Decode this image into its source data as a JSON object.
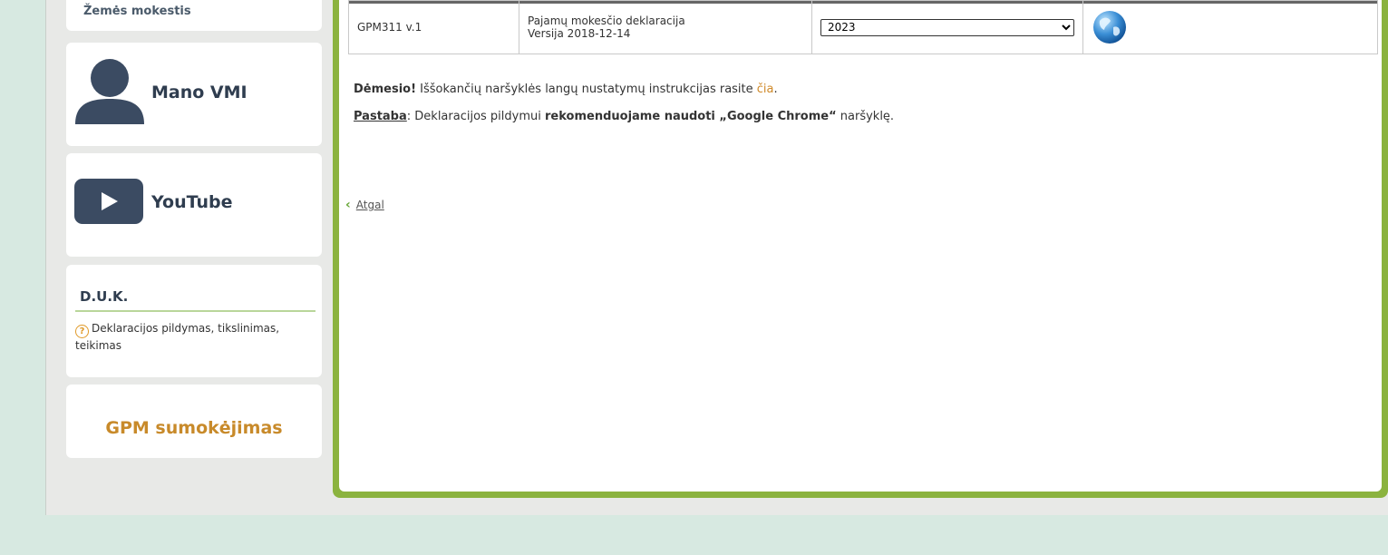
{
  "sidebar": {
    "land_tax": "Žemės mokestis",
    "mano_vmi": "Mano VMI",
    "youtube": "YouTube",
    "duk_title": "D.U.K.",
    "duk_link": "Deklaracijos pildymas, tikslinimas, teikimas",
    "gpm_payment": "GPM sumokėjimas"
  },
  "table": {
    "form_code": "GPM311 v.1",
    "form_name": "Pajamų mokesčio deklaracija",
    "form_version": "Versija 2018-12-14",
    "year_selected": "2023"
  },
  "notice": {
    "attention_label": "Dėmesio!",
    "attention_text": " Iššokančių naršyklės langų nustatymų instrukcijas rasite ",
    "link_here": "čia",
    "period": ".",
    "note_label": "Pastaba",
    "note_text_1": ": Deklaracijos pildymui ",
    "note_bold": "rekomenduojame naudoti „Google Chrome“",
    "note_text_2": " naršyklę."
  },
  "back_label": "Atgal",
  "colors": {
    "accent_green": "#8bb33f",
    "orange": "#c88a2a",
    "dark_slate": "#2f3d4f"
  }
}
